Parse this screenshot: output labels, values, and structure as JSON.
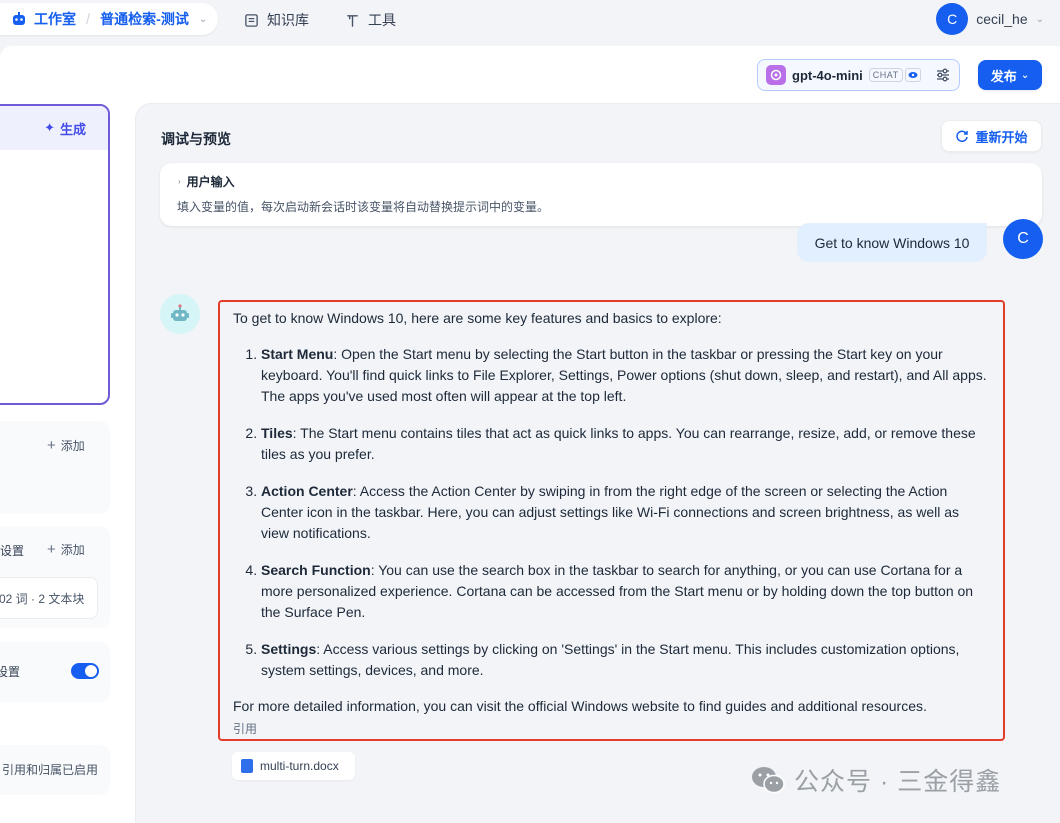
{
  "topbar": {
    "studio": "工作室",
    "separator": "/",
    "app_name": "普通检索-测试",
    "nav": [
      {
        "label": "知识库",
        "icon": "knowledge-icon"
      },
      {
        "label": "工具",
        "icon": "tools-icon"
      }
    ],
    "user": {
      "initial": "C",
      "name": "cecil_he"
    }
  },
  "toolbar": {
    "model": {
      "name": "gpt-4o-mini",
      "mode": "CHAT"
    },
    "publish_label": "发布"
  },
  "left_panel": {
    "generate_label": "生成",
    "add_label_1": "添加",
    "settings_partial_1": "设置",
    "add_label_2": "添加",
    "kb_meta": "02 词 · 2 文本块",
    "settings_partial_2": "设置",
    "citation_partial": "引用和归属已启用"
  },
  "preview": {
    "title": "调试与预览",
    "restart_label": "重新开始",
    "user_input": {
      "title": "用户输入",
      "desc": "填入变量的值，每次启动新会话时该变量将自动替换提示词中的变量。"
    },
    "user_avatar": "C",
    "user_message": "Get to know Windows 10",
    "answer": {
      "intro": "To get to know Windows 10, here are some key features and basics to explore:",
      "items": [
        {
          "title": "Start Menu",
          "text": ": Open the Start menu by selecting the Start button in the taskbar or pressing the Start key on your keyboard. You'll find quick links to File Explorer, Settings, Power options (shut down, sleep, and restart), and All apps. The apps you've used most often will appear at the top left."
        },
        {
          "title": "Tiles",
          "text": ": The Start menu contains tiles that act as quick links to apps. You can rearrange, resize, add, or remove these tiles as you prefer."
        },
        {
          "title": "Action Center",
          "text": ": Access the Action Center by swiping in from the right edge of the screen or selecting the Action Center icon in the taskbar. Here, you can adjust settings like Wi-Fi connections and screen brightness, as well as view notifications."
        },
        {
          "title": "Search Function",
          "text": ": You can use the search box in the taskbar to search for anything, or you can use Cortana for a more personalized experience. Cortana can be accessed from the Start menu or by holding down the top button on the Surface Pen."
        },
        {
          "title": "Settings",
          "text": ": Access various settings by clicking on 'Settings' in the Start menu. This includes customization options, system settings, devices, and more."
        }
      ],
      "outro": "For more detailed information, you can visit the official Windows website to find guides and additional resources.",
      "citation_label": "引用"
    },
    "citation_file": "multi-turn.docx"
  },
  "watermark": "公众号 · 三金得鑫",
  "colors": {
    "accent": "#155eef",
    "highlight_border": "#e33e2b",
    "prompt_border": "#6f5bd5"
  }
}
